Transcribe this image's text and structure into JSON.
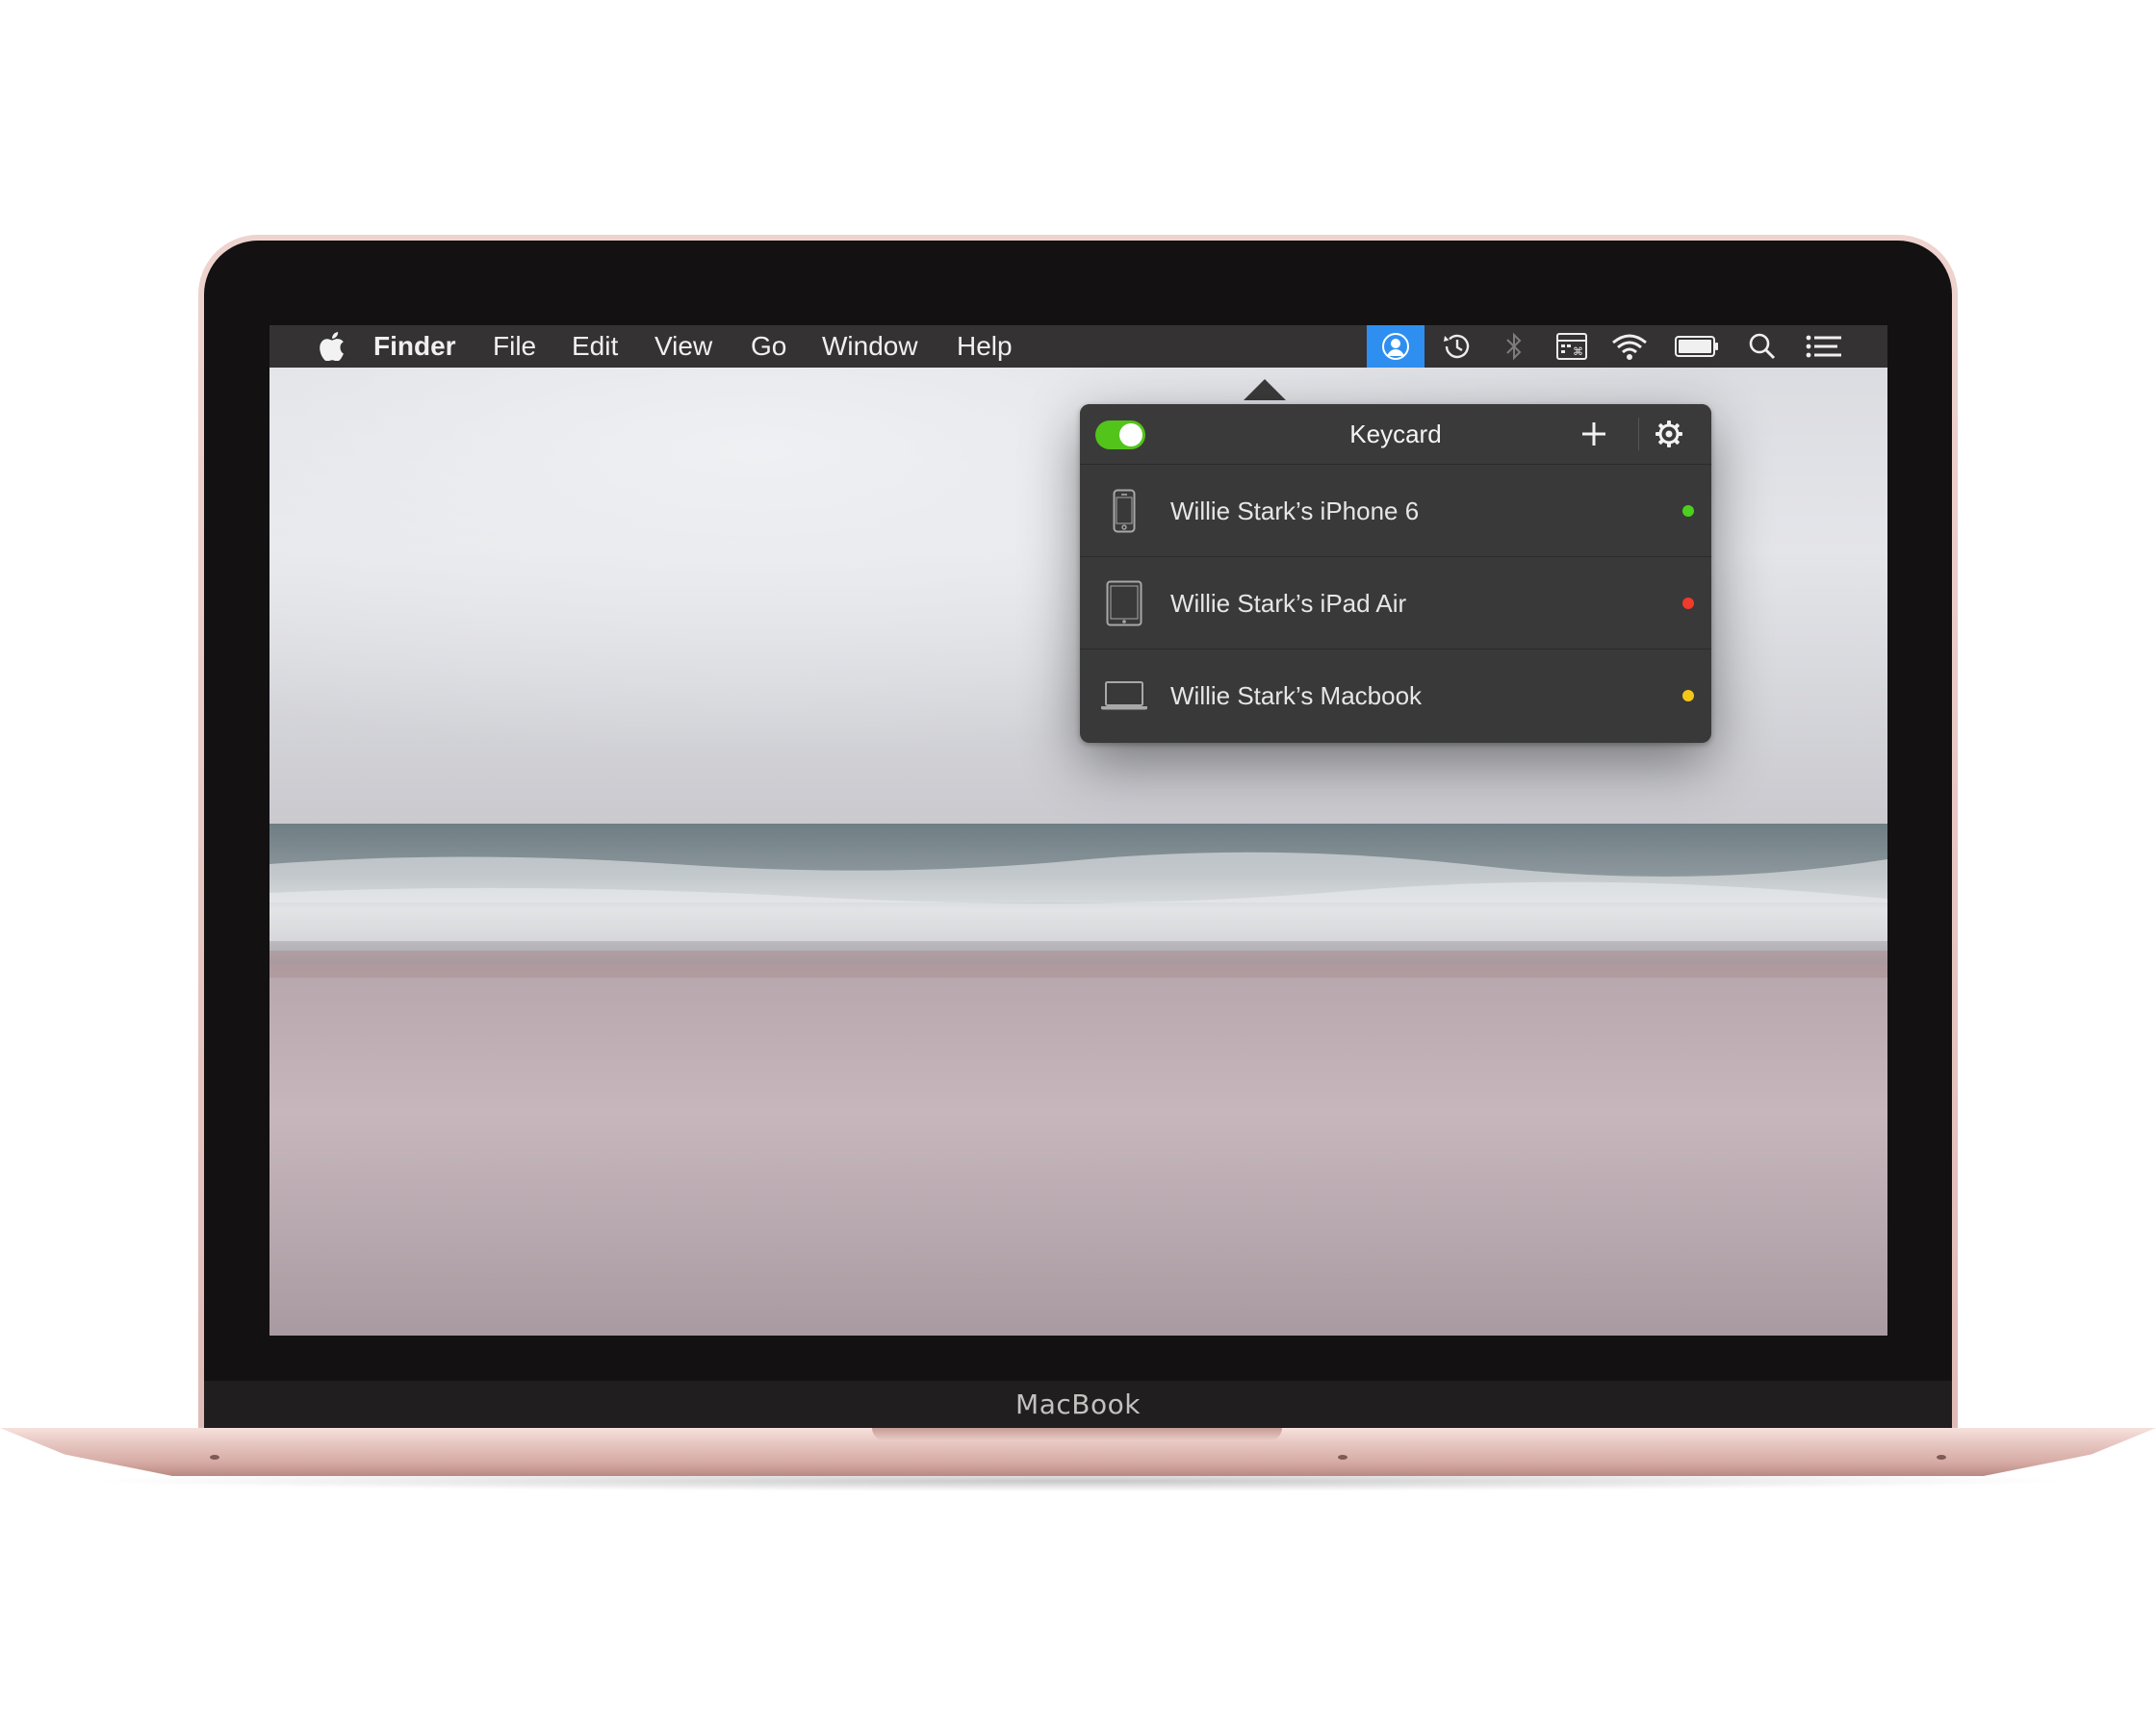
{
  "device": {
    "brand_label": "MacBook"
  },
  "menubar": {
    "app_name": "Finder",
    "items": [
      "File",
      "Edit",
      "View",
      "Go",
      "Window",
      "Help"
    ],
    "status_icons": [
      "keycard-user-icon",
      "time-machine-icon",
      "bluetooth-icon",
      "keyboard-viewer-icon",
      "wifi-icon",
      "battery-icon",
      "spotlight-search-icon",
      "notification-center-icon"
    ]
  },
  "popover": {
    "title": "Keycard",
    "toggle_on": true,
    "devices": [
      {
        "name": "Willie Stark’s iPhone 6",
        "icon": "iphone-icon",
        "status_color": "#4cd01e"
      },
      {
        "name": "Willie Stark’s iPad Air",
        "icon": "ipad-icon",
        "status_color": "#f03a2a"
      },
      {
        "name": "Willie Stark’s Macbook",
        "icon": "laptop-icon",
        "status_color": "#f5c61a"
      }
    ]
  },
  "colors": {
    "menubar_bg": "#343233",
    "active_status": "#2e8ff0",
    "toggle_on": "#52c41a",
    "popover_bg": "#3a3939"
  }
}
